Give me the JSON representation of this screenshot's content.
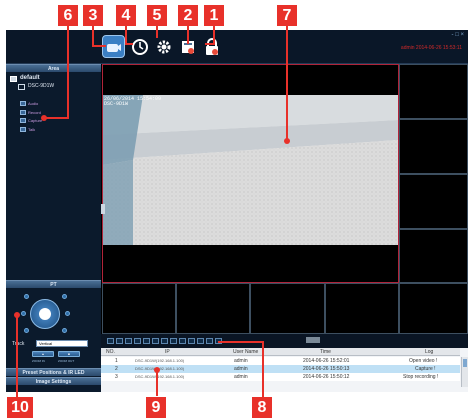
{
  "callouts": {
    "n1": "1",
    "n2": "2",
    "n3": "3",
    "n4": "4",
    "n5": "5",
    "n6": "6",
    "n7": "7",
    "n8": "8",
    "n9": "9",
    "n10": "10"
  },
  "colors": {
    "callout": "#e8312a",
    "app_background": "#0c1c30",
    "video_border": "#b0243a"
  },
  "header": {
    "user_status": "admin  2014-06-26  15:53:11",
    "window_controls": "- □ ×"
  },
  "sidebar": {
    "area_title": "Area",
    "root_label": "default",
    "device_label": "DSC-9D1W",
    "channels": [
      {
        "label": "Audio",
        "icon": "camera-channel-icon"
      },
      {
        "label": "Record",
        "icon": "camera-channel-icon"
      },
      {
        "label": "Capture",
        "icon": "camera-channel-icon"
      },
      {
        "label": "Talk",
        "icon": "camera-channel-icon"
      }
    ],
    "ptz_title": "PT",
    "track_label": "Track",
    "track_value": "Vertical",
    "zoom_in": "ZOOM IN",
    "zoom_out": "ZOOM OUT",
    "preset_title": "Preset Positions & IR LED",
    "image_title": "Image Settings"
  },
  "video": {
    "timestamp_line1": "26/06/2014 15:54:09",
    "timestamp_line2": "DSC-9D1W"
  },
  "log": {
    "columns": [
      "NO.",
      "IP",
      "User Name",
      "Time",
      "Log"
    ],
    "rows": [
      {
        "no": "1",
        "ip": "DSC-9D1W(192.168.1.100)",
        "user": "admin",
        "time": "2014-06-26 15:52:01",
        "log": "Open video !"
      },
      {
        "no": "2",
        "ip": "DSC-9D1W(192.168.1.100)",
        "user": "admin",
        "time": "2014-06-26 15:50:13",
        "log": "Capture !"
      },
      {
        "no": "3",
        "ip": "DSC-9D1W(192.168.1.100)",
        "user": "admin",
        "time": "2014-06-26 15:50:12",
        "log": "Stop recording !"
      }
    ]
  },
  "icons": {
    "live_view": "camera-icon",
    "playback": "playback-icon",
    "settings": "gear-icon",
    "config": "config-icon",
    "lock": "lock-icon"
  }
}
